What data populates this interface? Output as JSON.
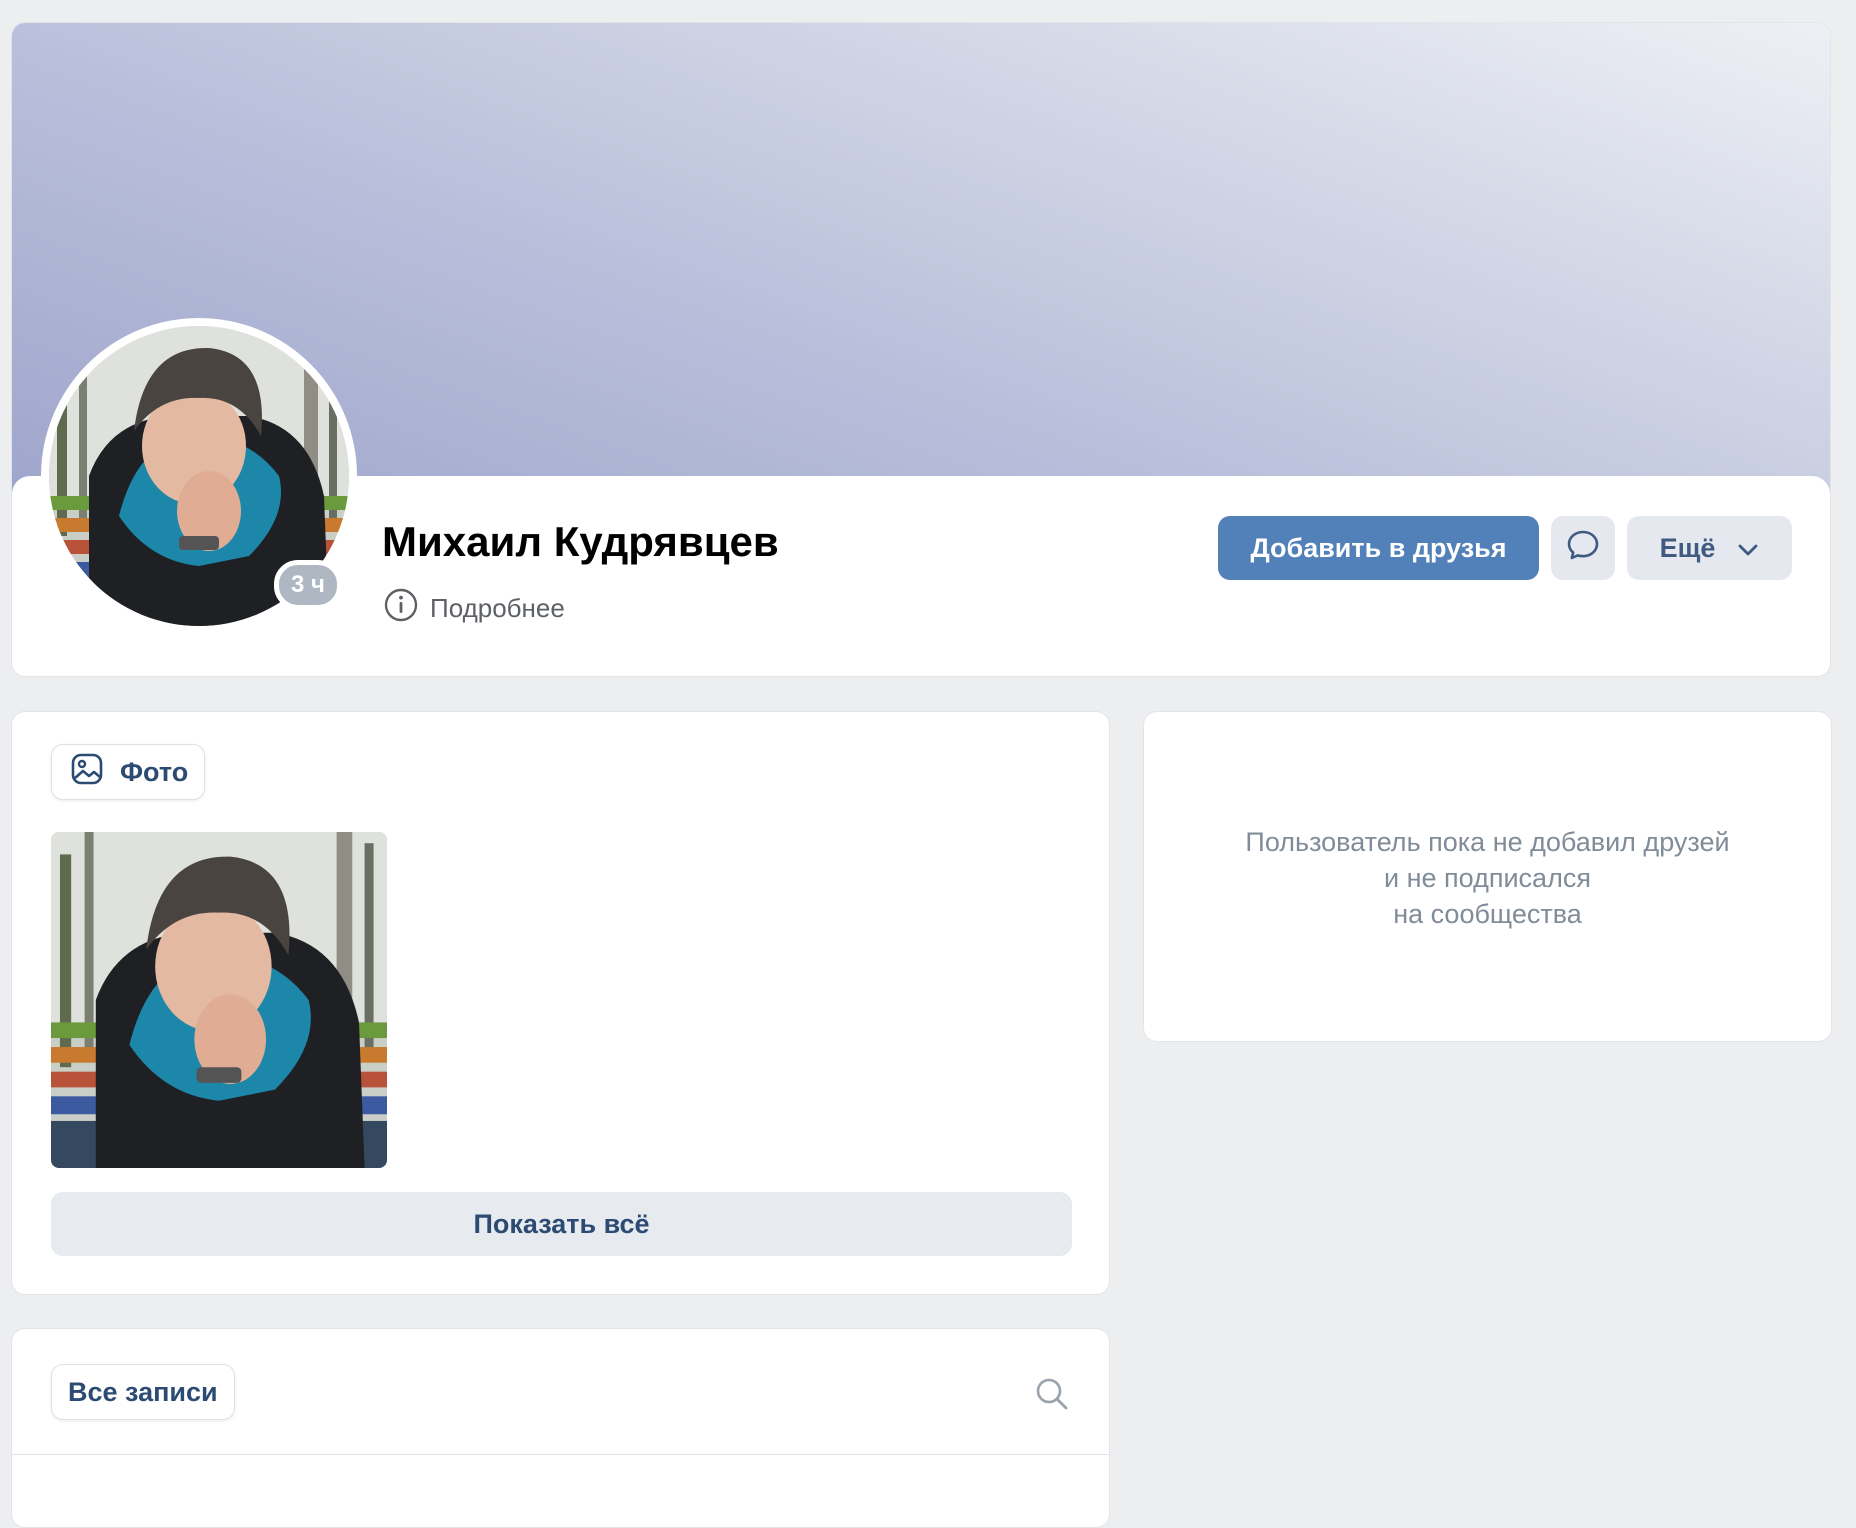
{
  "profile": {
    "name": "Михаил Кудрявцев",
    "last_seen": "3 ч",
    "details_label": "Подробнее",
    "add_friend_label": "Добавить в друзья",
    "more_label": "Ещё"
  },
  "photos": {
    "tab_label": "Фото",
    "show_all_label": "Показать всё"
  },
  "friends": {
    "empty_line1": "Пользователь пока не добавил друзей",
    "empty_line2": "и не подписался",
    "empty_line3": "на сообщества"
  },
  "posts": {
    "tab_label": "Все записи"
  },
  "icons": {
    "details": "info-circle-icon",
    "message": "message-bubble-icon",
    "more": "chevron-down-icon",
    "photo": "image-icon",
    "search": "search-icon"
  },
  "colors": {
    "accent": "#5181b8",
    "secondary_button": "#e5e9ef",
    "link_text": "#2c4b73",
    "background": "#edeef0"
  }
}
